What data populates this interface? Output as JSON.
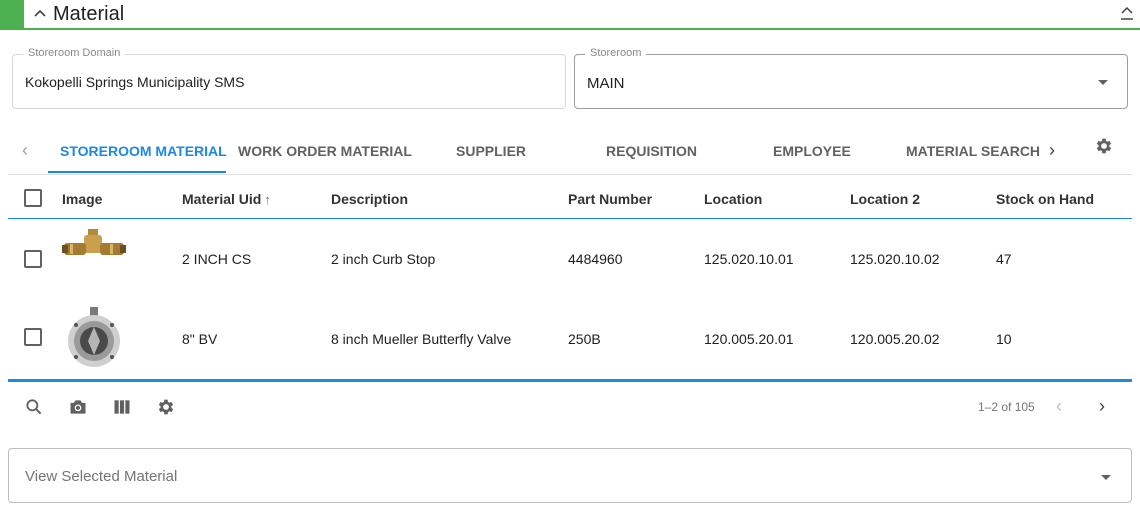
{
  "section": {
    "title": "Material"
  },
  "fields": {
    "storeroom_domain": {
      "label": "Storeroom Domain",
      "value": "Kokopelli Springs Municipality SMS"
    },
    "storeroom": {
      "label": "Storeroom",
      "value": "MAIN"
    }
  },
  "tabs": [
    {
      "label": "STOREROOM MATERIAL",
      "active": true
    },
    {
      "label": "WORK ORDER MATERIAL",
      "active": false
    },
    {
      "label": "SUPPLIER",
      "active": false
    },
    {
      "label": "REQUISITION",
      "active": false
    },
    {
      "label": "EMPLOYEE",
      "active": false
    },
    {
      "label": "MATERIAL SEARCH",
      "active": false
    }
  ],
  "table": {
    "columns": [
      "Image",
      "Material Uid",
      "Description",
      "Part Number",
      "Location",
      "Location 2",
      "Stock on Hand"
    ],
    "sort_indicator": "↑",
    "rows": [
      {
        "image": "curb-stop-image",
        "material_uid": "2 INCH CS",
        "description": "2 inch Curb Stop",
        "part_number": "4484960",
        "location": "125.020.10.01",
        "location_2": "125.020.10.02",
        "stock_on_hand": "47"
      },
      {
        "image": "butterfly-valve-image",
        "material_uid": "8\" BV",
        "description": "8 inch Mueller Butterfly Valve",
        "part_number": "250B",
        "location": "120.005.20.01",
        "location_2": "120.005.20.02",
        "stock_on_hand": "10"
      }
    ]
  },
  "footer": {
    "tools": [
      "search-icon",
      "camera-icon",
      "columns-icon",
      "gear-icon"
    ],
    "pagination": "1–2 of 105"
  },
  "view_selected": {
    "placeholder": "View Selected Material"
  },
  "colors": {
    "accent_green": "#4caf50",
    "accent_blue": "#1e88e5"
  }
}
